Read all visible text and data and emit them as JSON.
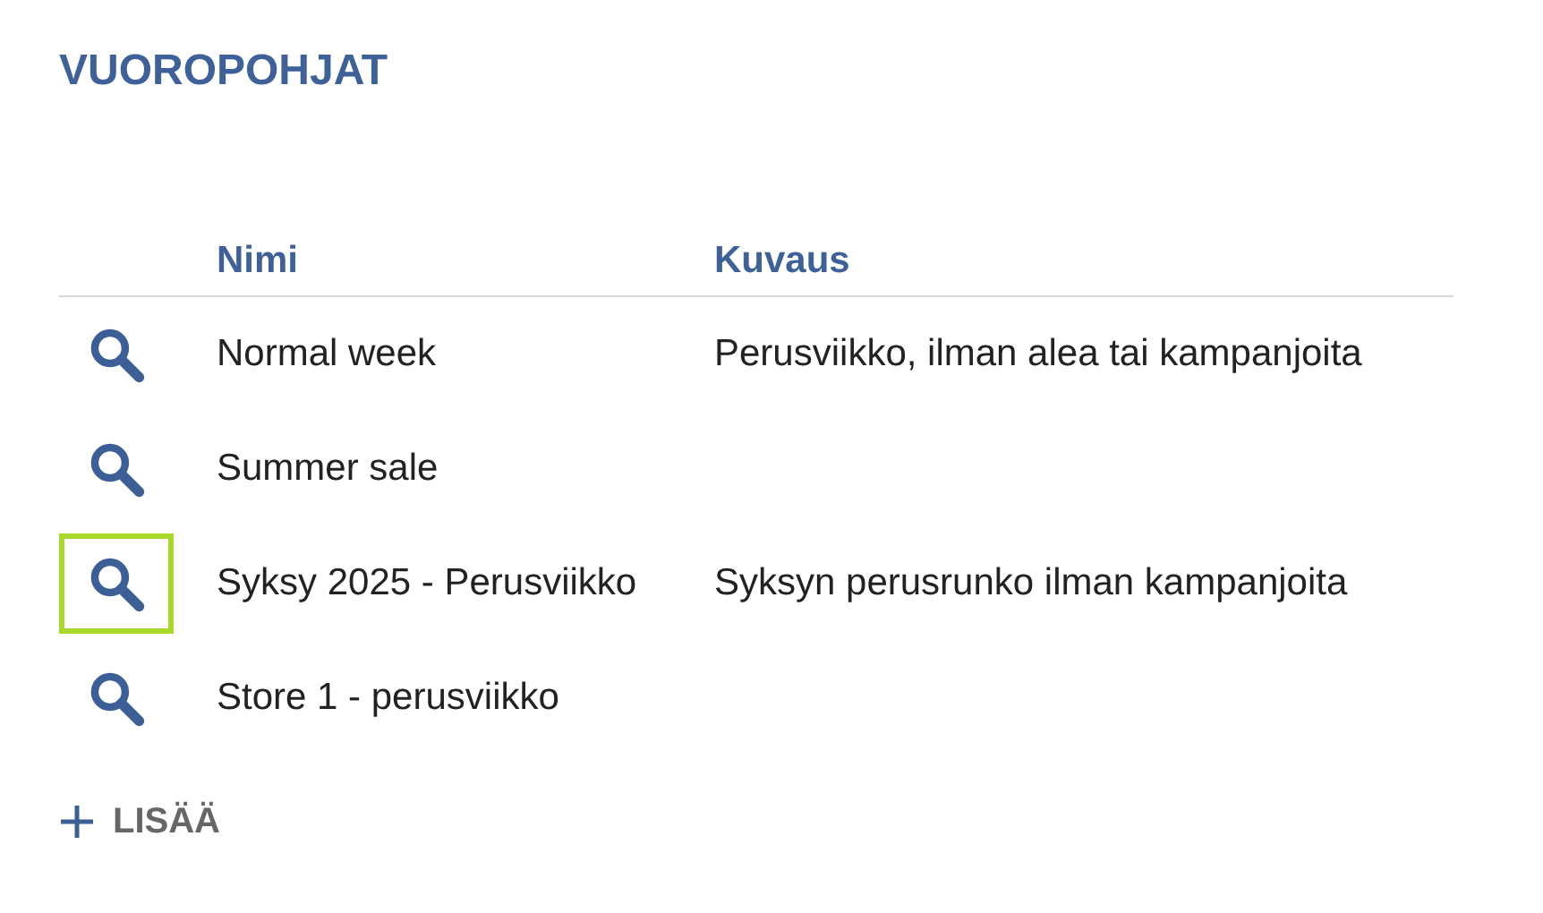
{
  "title": "VUOROPOHJAT",
  "table": {
    "columns": [
      "Nimi",
      "Kuvaus"
    ],
    "rows": [
      {
        "name": "Normal week",
        "description": "Perusviikko, ilman alea tai kampanjoita",
        "focused": false
      },
      {
        "name": "Summer sale",
        "description": "",
        "focused": false
      },
      {
        "name": "Syksy 2025 - Perusviikko",
        "description": "Syksyn perusrunko ilman kampanjoita",
        "focused": true
      },
      {
        "name": "Store 1 - perusviikko",
        "description": "",
        "focused": false
      }
    ]
  },
  "add_button": {
    "label": "LISÄÄ"
  }
}
